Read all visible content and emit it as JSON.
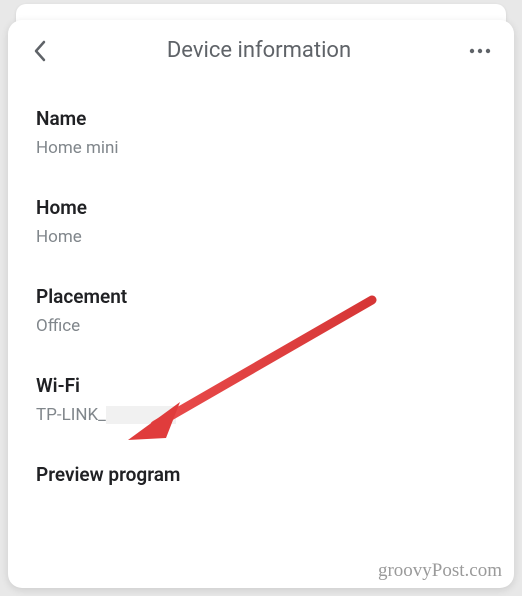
{
  "header": {
    "title": "Device information"
  },
  "sections": {
    "name": {
      "label": "Name",
      "value": "Home mini"
    },
    "home": {
      "label": "Home",
      "value": "Home"
    },
    "placement": {
      "label": "Placement",
      "value": "Office"
    },
    "wifi": {
      "label": "Wi-Fi",
      "value_prefix": "TP-LINK_"
    },
    "preview": {
      "label": "Preview program"
    }
  },
  "watermark": "groovyPost.com"
}
